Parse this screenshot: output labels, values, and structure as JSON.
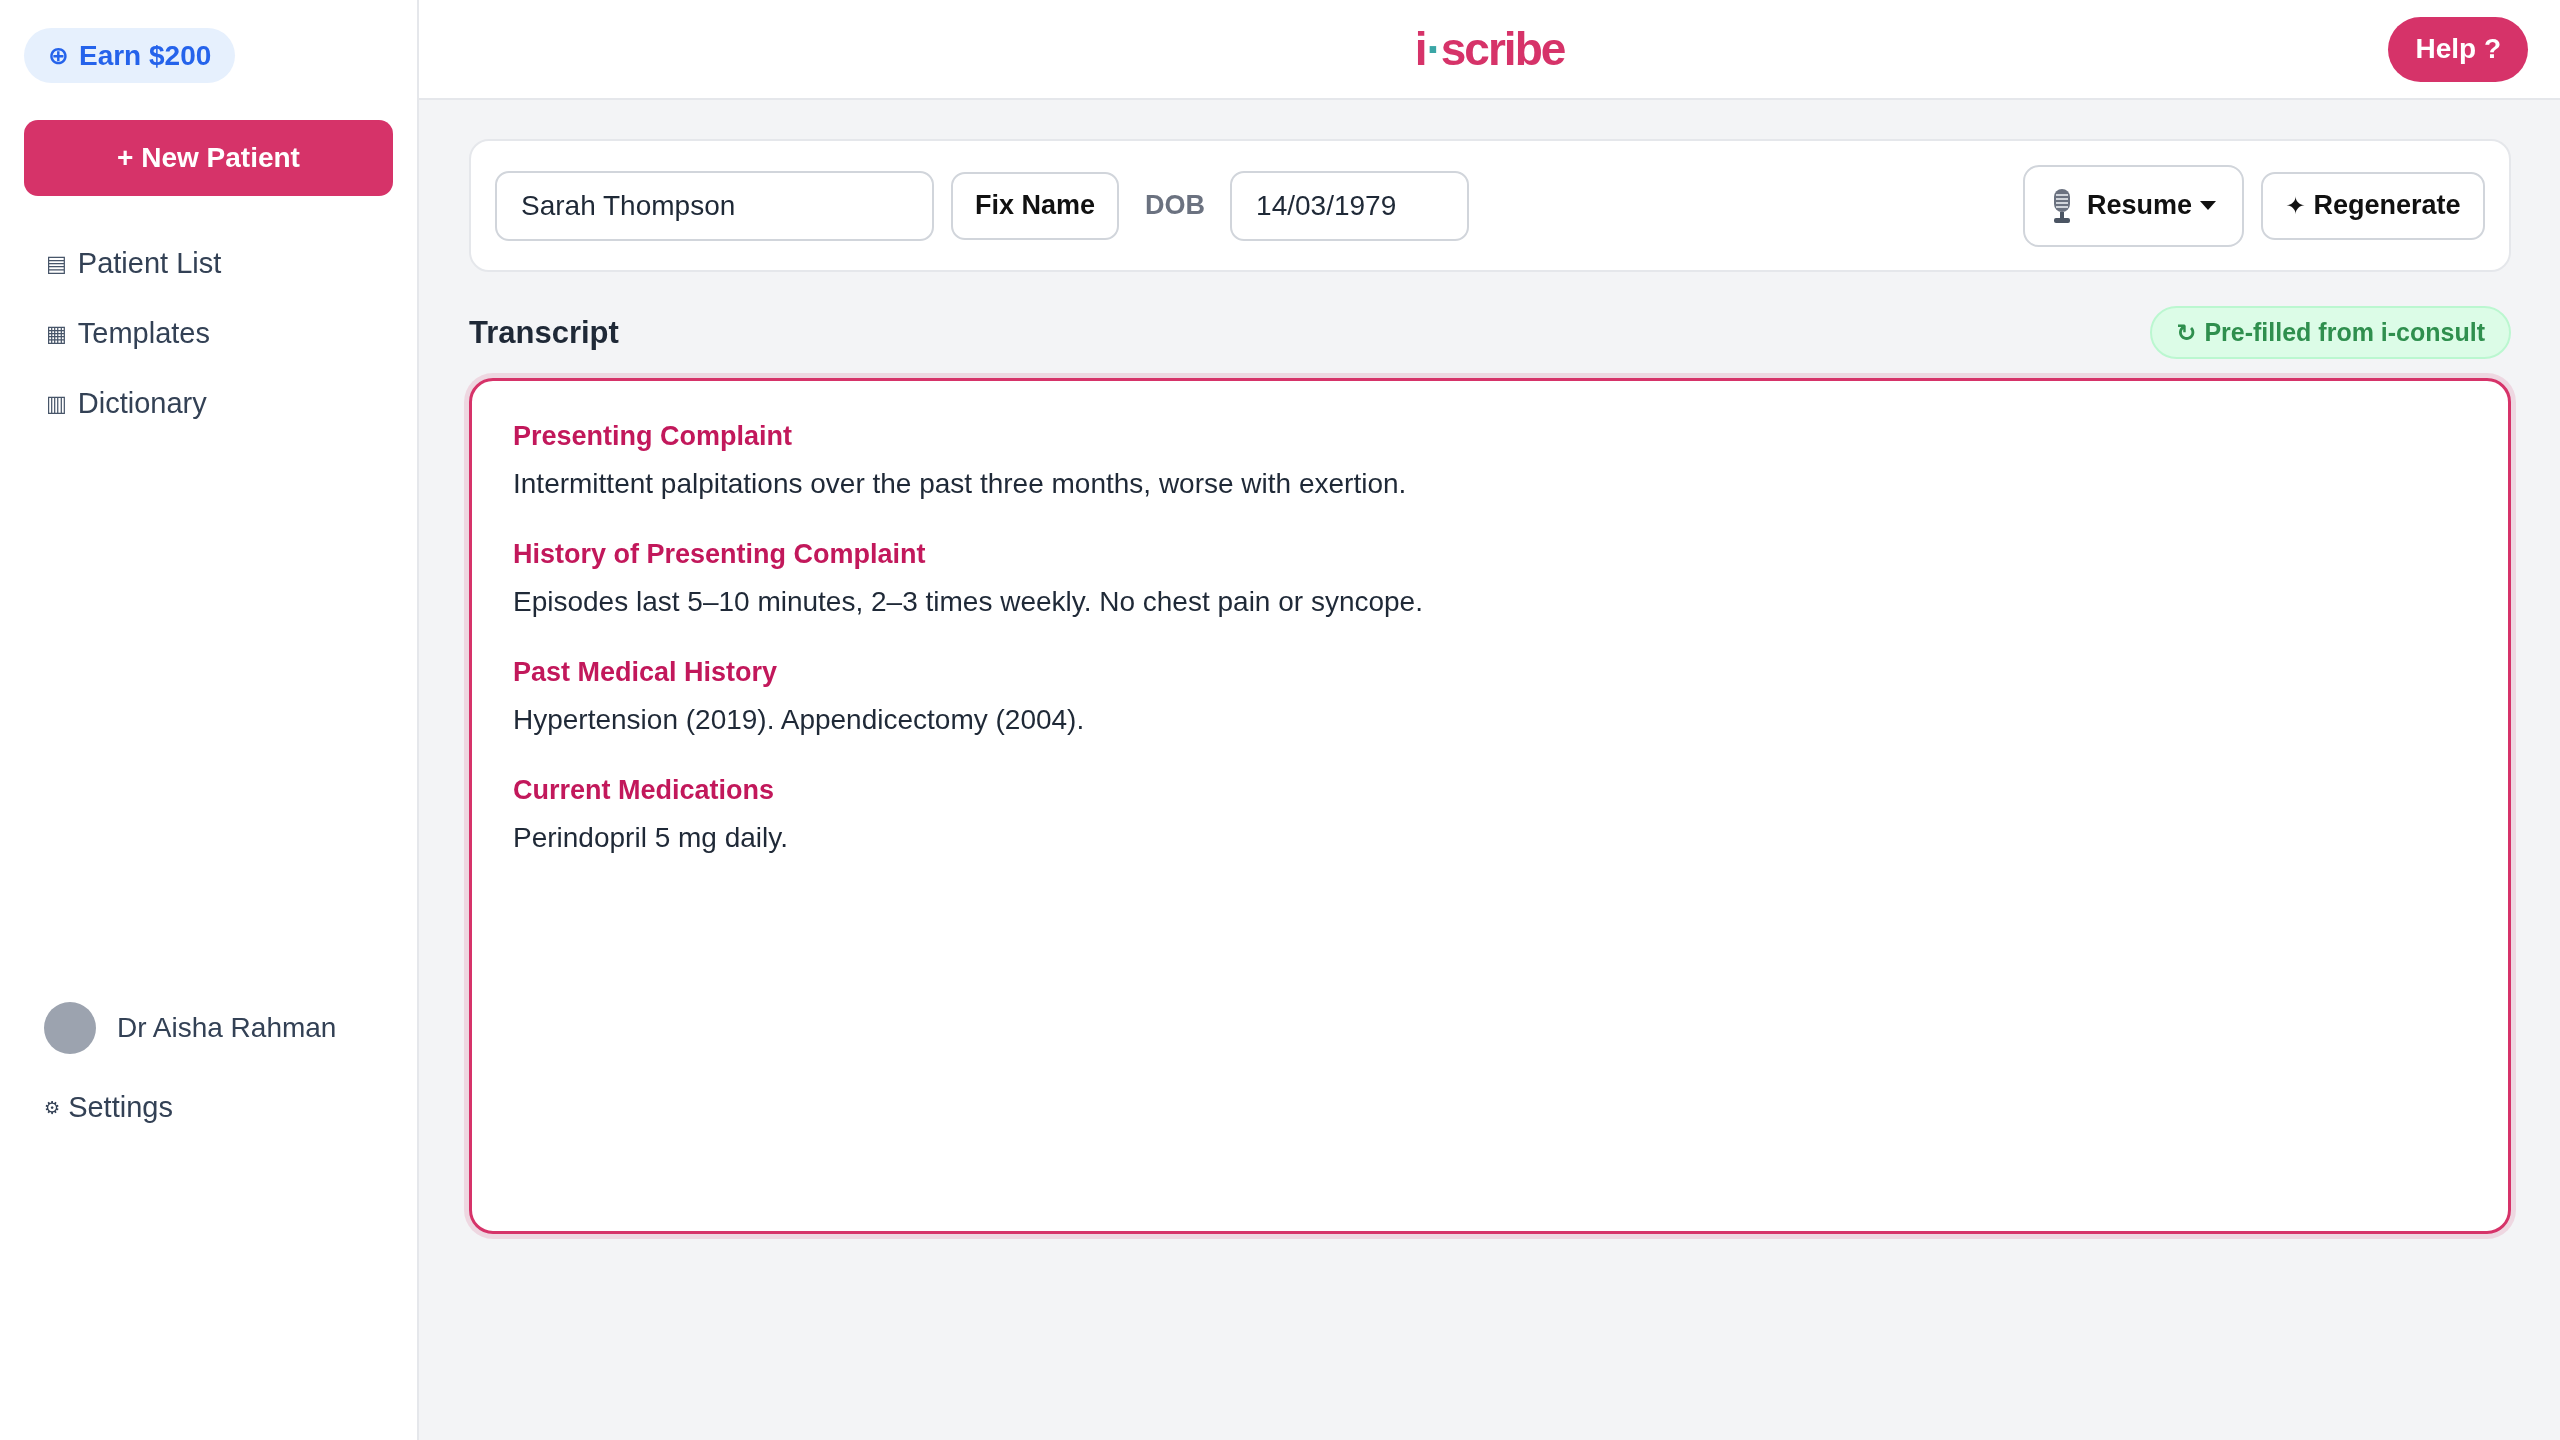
{
  "sidebar": {
    "promo": {
      "icon": "⊕",
      "label": "Earn $200"
    },
    "new_patient_button": "+ New Patient",
    "nav_items": [
      {
        "icon": "▤",
        "label": "Patient List",
        "selected": false
      },
      {
        "icon": "▦",
        "label": "Templates",
        "selected": false
      },
      {
        "icon": "▥",
        "label": "Dictionary",
        "selected": false
      }
    ],
    "user": {
      "name": "Dr Aisha Rahman"
    },
    "settings": {
      "icon": "⚙",
      "label": "Settings"
    }
  },
  "header": {
    "logo": {
      "lead": "i",
      "dot": "·",
      "rest": "scribe"
    },
    "help_button": "Help ?"
  },
  "patient_bar": {
    "name_field": {
      "value": "Sarah Thompson"
    },
    "fix_name_button": "Fix Name",
    "dob_label": "DOB",
    "dob_field": {
      "value": "14/03/1979"
    },
    "resume_button": {
      "label": "Resume"
    },
    "regenerate_button": {
      "icon": "✦",
      "label": "Regenerate"
    }
  },
  "transcript": {
    "title": "Transcript",
    "source_badge": {
      "icon": "↻",
      "label": "Pre-filled from i-consult"
    },
    "sections": [
      {
        "heading": "Presenting Complaint",
        "text": "Intermittent palpitations over the past three months, worse with exertion."
      },
      {
        "heading": "History of Presenting Complaint",
        "text": "Episodes last 5–10 minutes, 2–3 times weekly. No chest pain or syncope."
      },
      {
        "heading": "Past Medical History",
        "text": "Hypertension (2019). Appendicectomy (2004)."
      },
      {
        "heading": "Current Medications",
        "text": "Perindopril 5 mg daily."
      }
    ]
  }
}
